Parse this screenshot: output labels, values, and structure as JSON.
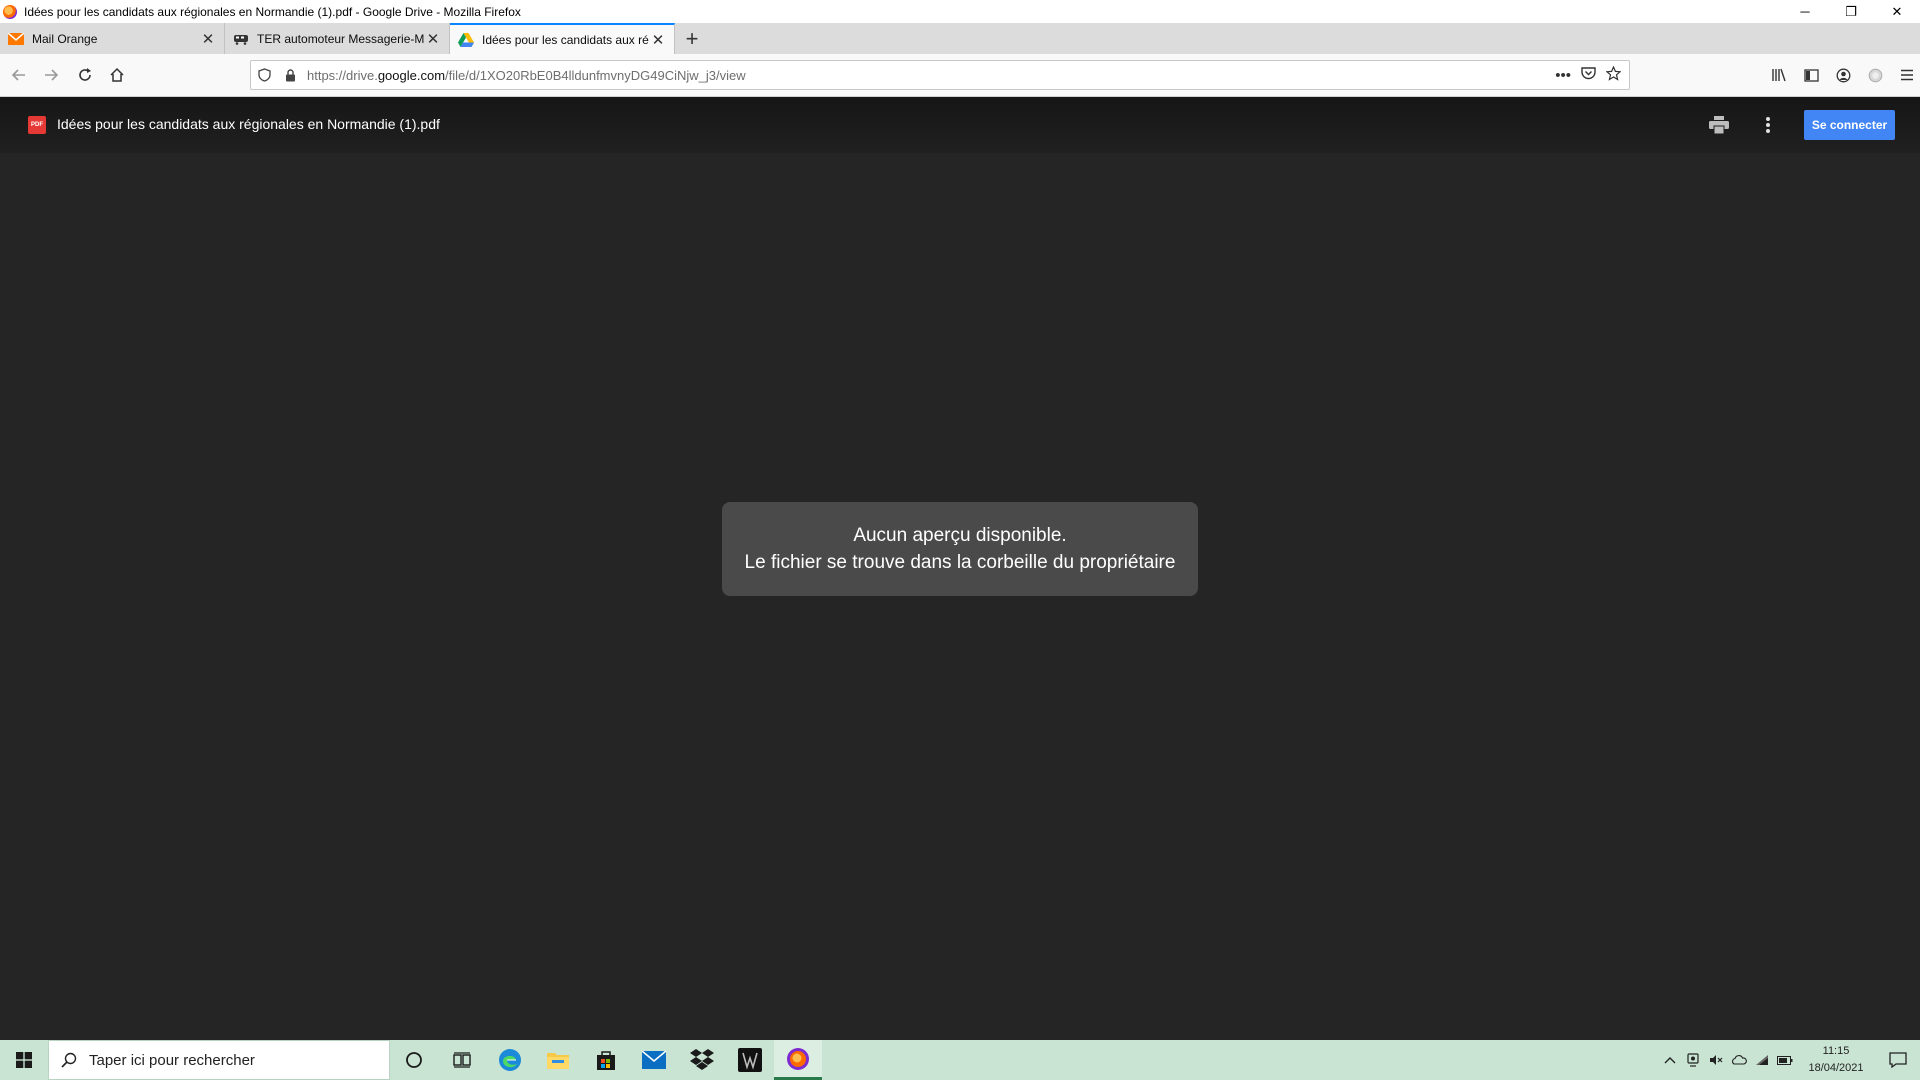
{
  "window": {
    "title": "Idées pour les candidats aux régionales en Normandie (1).pdf - Google Drive - Mozilla Firefox",
    "minimize": "─",
    "restore": "❐",
    "close": "✕"
  },
  "tabs": [
    {
      "label": "Mail Orange",
      "icon": "envelope-icon",
      "active": false
    },
    {
      "label": "TER automoteur Messagerie-M",
      "icon": "train-icon",
      "active": false
    },
    {
      "label": "Idées pour les candidats aux ré",
      "icon": "google-drive-icon",
      "active": true
    }
  ],
  "new_tab_label": "+",
  "tab_close_label": "✕",
  "urlbar": {
    "prefix": "https://drive.",
    "domain": "google.com",
    "path": "/file/d/1XO20RbE0B4lldunfmvnyDG49CiNjw_j3/view"
  },
  "drive": {
    "file_title": "Idées pour les candidats aux régionales en Normandie (1).pdf",
    "pdf_badge": "PDF",
    "signin_label": "Se connecter"
  },
  "message": {
    "line1": "Aucun aperçu disponible.",
    "line2": "Le fichier se trouve dans la corbeille du propriétaire"
  },
  "taskbar": {
    "search_placeholder": "Taper ici pour rechercher",
    "time": "11:15",
    "date": "18/04/2021"
  },
  "colors": {
    "accent": "#4285f4",
    "viewer_bg": "#252525",
    "taskbar_bg": "#c9e4d3",
    "message_bg": "#4a4a4a"
  }
}
